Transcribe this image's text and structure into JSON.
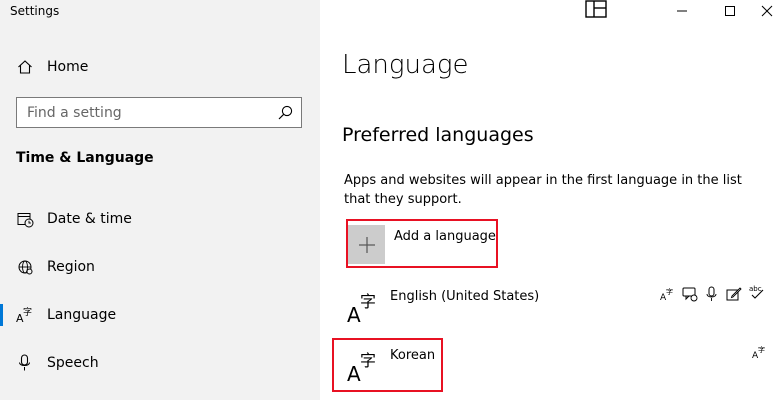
{
  "window": {
    "title": "Settings"
  },
  "sidebar": {
    "home_label": "Home",
    "search_placeholder": "Find a setting",
    "section_title": "Time & Language",
    "items": [
      {
        "label": "Date & time",
        "icon": "calendar-clock-icon"
      },
      {
        "label": "Region",
        "icon": "globe-icon"
      },
      {
        "label": "Language",
        "icon": "language-icon",
        "active": true
      },
      {
        "label": "Speech",
        "icon": "microphone-icon"
      }
    ]
  },
  "main": {
    "title": "Language",
    "preferred_title": "Preferred languages",
    "description": "Apps and websites will appear in the first language in the list that they support.",
    "add_language_label": "Add a language",
    "languages": [
      {
        "name": "English (United States)",
        "features": [
          "display-language-icon",
          "speech-icon",
          "microphone-icon",
          "handwriting-icon",
          "spellcheck-icon"
        ]
      },
      {
        "name": "Korean",
        "features": [
          "spellcheck-icon"
        ]
      }
    ]
  },
  "colors": {
    "accent": "#0078d7",
    "highlight_box": "#e81123",
    "sidebar_bg": "#f2f2f2"
  }
}
